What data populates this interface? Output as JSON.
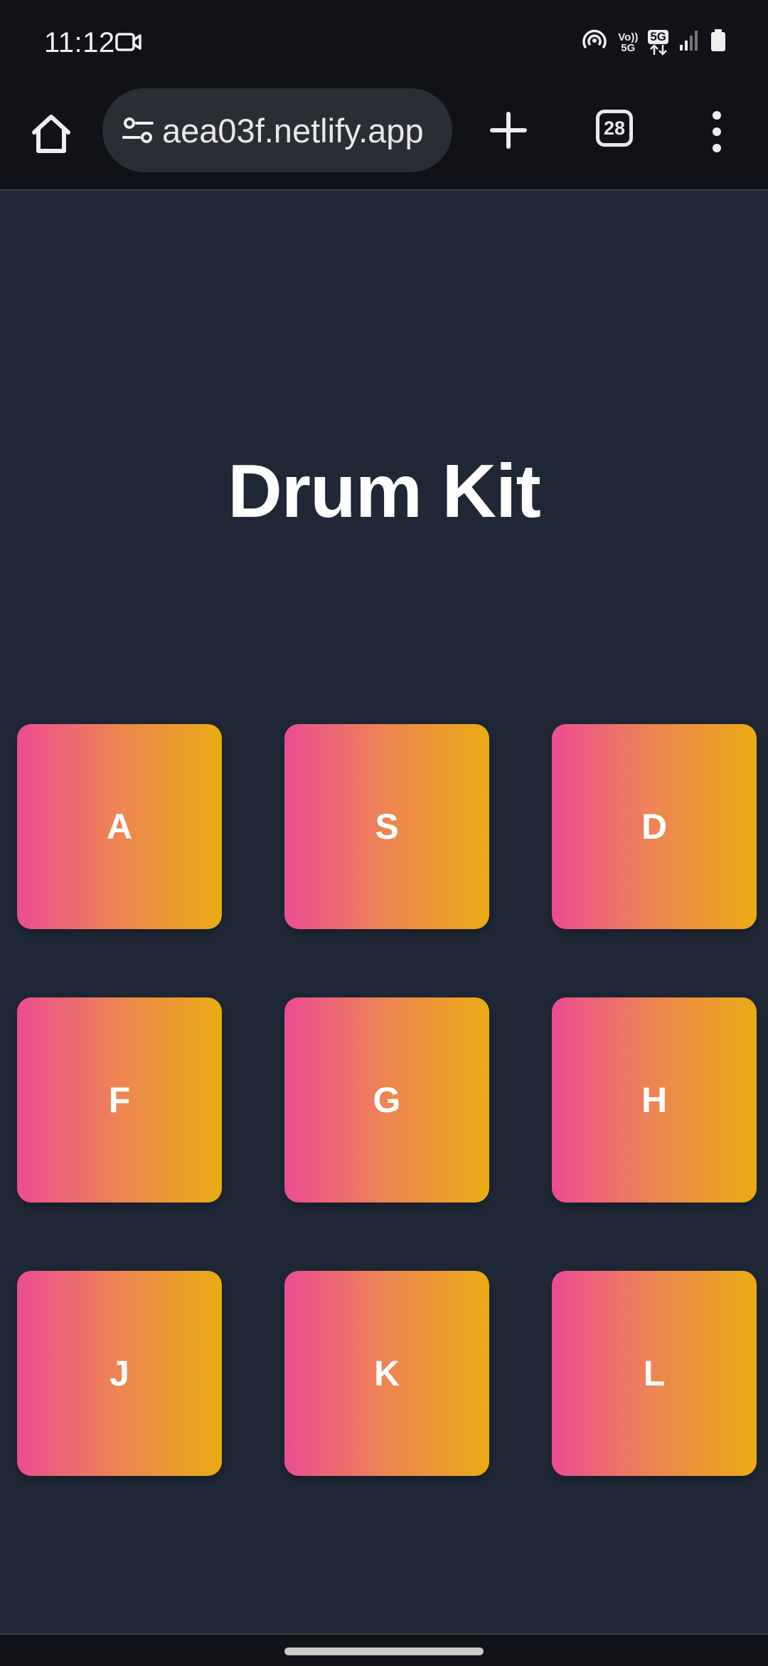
{
  "status_bar": {
    "time": "11:12",
    "volte_top": "Vo))",
    "volte_bottom": "5G",
    "network": "5G",
    "icons": [
      "video-camera-icon",
      "hotspot-icon",
      "volte-icon",
      "5g-icon",
      "signal-icon",
      "battery-icon"
    ]
  },
  "browser": {
    "url": "aea03f.netlify.app",
    "tab_count": "28",
    "icons": [
      "home-icon",
      "site-settings-icon",
      "plus-icon",
      "tabs-icon",
      "more-vertical-icon"
    ]
  },
  "page": {
    "title": "Drum Kit",
    "pads": [
      {
        "key": "A"
      },
      {
        "key": "S"
      },
      {
        "key": "D"
      },
      {
        "key": "F"
      },
      {
        "key": "G"
      },
      {
        "key": "H"
      },
      {
        "key": "J"
      },
      {
        "key": "K"
      },
      {
        "key": "L"
      }
    ]
  },
  "colors": {
    "page_background": "#1f2736",
    "bar_background": "#101217",
    "pad_gradient_start": "#ec4c93",
    "pad_gradient_end": "#eaab14",
    "text": "#ffffff"
  }
}
